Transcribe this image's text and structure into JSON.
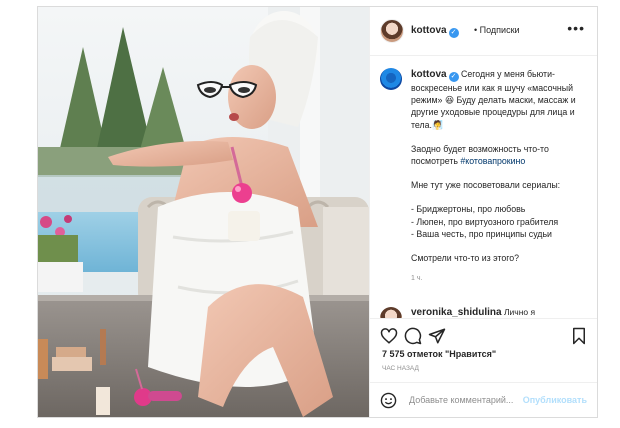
{
  "post": {
    "username": "kottova",
    "verified_icon": "verified-badge-icon",
    "follow_label": "• Подписки",
    "more_label": "•••"
  },
  "caption": {
    "author": "kottova",
    "line1": "Сегодня у меня бьюти-воскресенье или как я шучу «масочный режим» 😆 Буду делать маски, массаж и другие уходовые процедуры для лица и тела.🧖",
    "line2_prefix": "Заодно будет возможность что-то посмотреть ",
    "hashtag": "#котовапрокино",
    "line3": "Мне тут уже посоветовали сериалы:",
    "list": [
      "- Бриджертоны, про любовь",
      "- Люпен, про виртуозного грабителя",
      "- Ваша честь, про принципы судьи"
    ],
    "question": "Смотрели что-то из этого?",
    "time": "1 ч."
  },
  "next_comment": {
    "author": "veronika_shidulina",
    "text": "Лично я"
  },
  "actions": {
    "likes": "7 575 отметок \"Нравится\"",
    "time_ago": "ЧАС НАЗАД"
  },
  "add_comment": {
    "placeholder": "Добавьте комментарий...",
    "publish_label": "Опубликовать"
  },
  "colors": {
    "verified": "#3897f0",
    "link": "#00376b",
    "publish_disabled": "#b2dffc"
  }
}
